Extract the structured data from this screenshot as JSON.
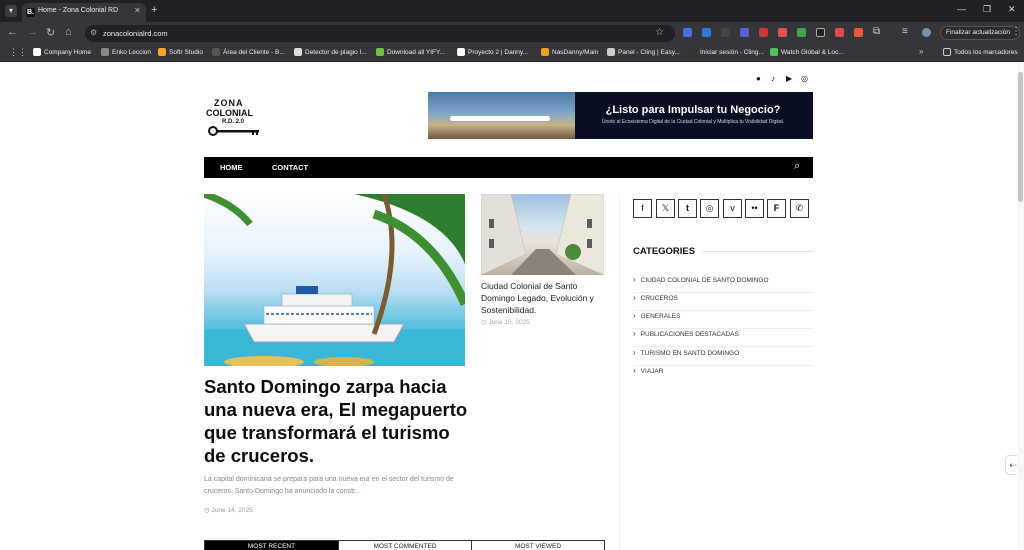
{
  "browser": {
    "tab_title": "Home - Zona Colonial RD",
    "tab_favicon": "B.",
    "url": "zonacolonialrd.com",
    "update_label": "Finalizar actualización",
    "all_bookmarks": "Todos los marcadores",
    "bookmarks": [
      {
        "label": "Company Home",
        "color": "#ffffff"
      },
      {
        "label": "Enko Leccion",
        "color": "#888888"
      },
      {
        "label": "Softr Studio",
        "color": "#f5a623"
      },
      {
        "label": "Área del Cliente - B...",
        "color": "#555555"
      },
      {
        "label": "Detector de plagio I...",
        "color": "#dddddd"
      },
      {
        "label": "Download all YIFY...",
        "color": "#6fbf3f"
      },
      {
        "label": "Proyecto 2 | Danny...",
        "color": "#ffffff"
      },
      {
        "label": "NasDanny/Main",
        "color": "#f0a020"
      },
      {
        "label": "Panel - Cling | Easy...",
        "color": "#cccccc"
      },
      {
        "label": "Iniciar sesión - Cling...",
        "color": "#333333"
      },
      {
        "label": "Watch Global & Loc...",
        "color": "#55c05a"
      }
    ]
  },
  "site": {
    "logo_line1": "ZONA",
    "logo_line2": "COLONIAL",
    "logo_line3": "R.D. 2.0",
    "social_top": [
      "facebook-icon",
      "tiktok-icon",
      "youtube-icon",
      "instagram-icon"
    ],
    "banner": {
      "title": "¿Listo para Impulsar tu Negocio?",
      "subtitle": "Únete al Ecosistema Digital de la Ciudad Colonial y Multiplica tu Visibilidad Digital."
    },
    "nav": {
      "home": "HOME",
      "contact": "CONTACT"
    },
    "hero": {
      "title": "Santo Domingo zarpa hacia una nueva era, El megapuerto que transformará el turismo de cruceros.",
      "excerpt": "La capital dominicana se prepara para una nueva era en el sector del turismo de cruceros. Santo Domingo ha anunciado la constr...",
      "date": "June 14, 2025"
    },
    "side_article": {
      "title": "Ciudad Colonial de Santo Domingo Legado, Evolución y Sostenibilidad.",
      "date": "June 15, 2025"
    },
    "post_tabs": [
      "MOST RECENT",
      "MOST COMMENTED",
      "MOST VIEWED"
    ],
    "sidebar_social": [
      "facebook",
      "x",
      "tumblr",
      "instagram",
      "vimeo",
      "flickr",
      "foursquare",
      "whatsapp"
    ],
    "categories_heading": "CATEGORIES",
    "categories": [
      "CIUDAD COLONIAL DE SANTO DOMINGO",
      "CRUCEROS",
      "GENERALES",
      "PUBLICACIONES DESTACADAS",
      "TURISMO EN SANTO DOMINGO",
      "VIAJAR"
    ]
  }
}
